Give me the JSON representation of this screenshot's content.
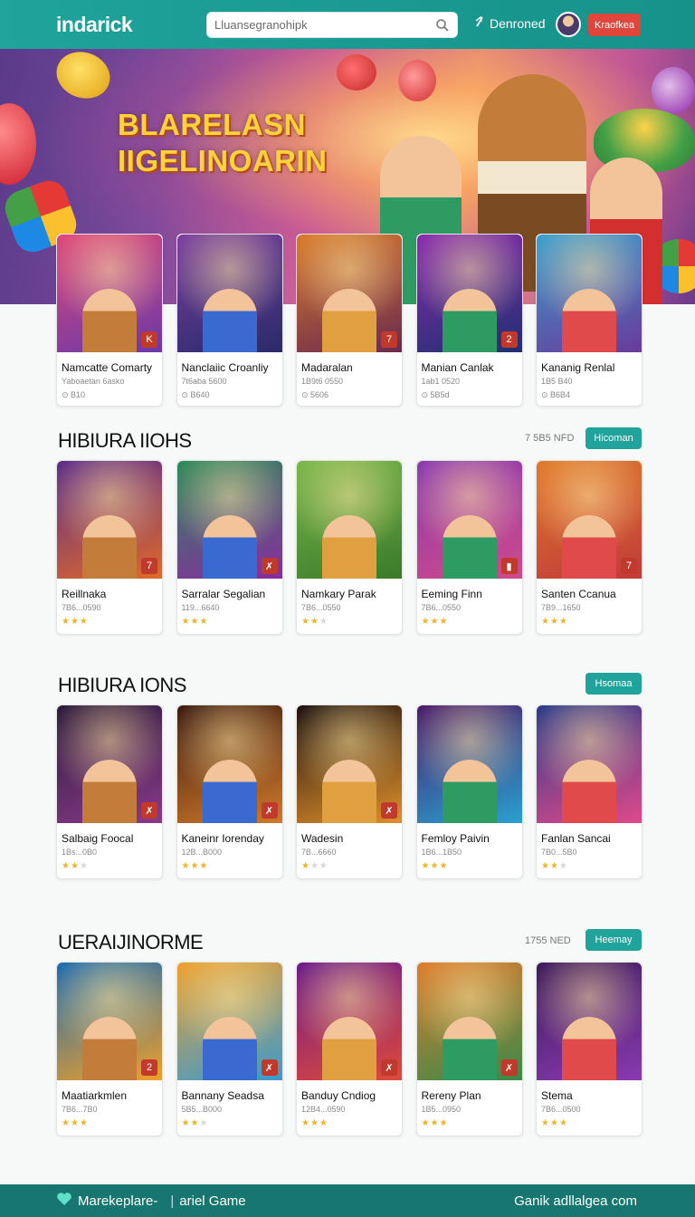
{
  "header": {
    "logo": "indarick",
    "search_placeholder": "Lluansegranohipk",
    "nav_download": "Denroned",
    "action_button": "Kraofkea"
  },
  "hero": {
    "title_line1": "BLARELASN",
    "title_line2": "IIGELINOARIN"
  },
  "featured": [
    {
      "title": "Namcatte Comarty",
      "sub": "Yaboaetan 6asko",
      "meta": "⊙ B10",
      "badge": "K"
    },
    {
      "title": "Nanclaiic Croanliy",
      "sub": "7t6aba 5600",
      "meta": "⊙ B640",
      "badge": ""
    },
    {
      "title": "Madaralan",
      "sub": "1B9t6 0550",
      "meta": "⊙ 5606",
      "badge": "7"
    },
    {
      "title": "Manian Canlak",
      "sub": "1ab1 0520",
      "meta": "⊙ 5B5d",
      "badge": "2"
    },
    {
      "title": "Kananig Renlal",
      "sub": "1B5 B40",
      "meta": "⊙ B6B4",
      "badge": ""
    }
  ],
  "sections": [
    {
      "title": "HIBIURA IIOHS",
      "count": "7 5B5 NFD",
      "button": "Hicoman",
      "items": [
        {
          "title": "Reillnaka",
          "sub": "7B6...0590",
          "rating": 3,
          "badge": "7"
        },
        {
          "title": "Sarralar Segalian",
          "sub": "119...6640",
          "rating": 3,
          "badge": "✗"
        },
        {
          "title": "Namkary Parak",
          "sub": "7B6...0550",
          "rating": 2,
          "badge": ""
        },
        {
          "title": "Eeming Finn",
          "sub": "7B6...0550",
          "rating": 3,
          "badge": "▮"
        },
        {
          "title": "Santen Ccanua",
          "sub": "7B9...1650",
          "rating": 3,
          "badge": "7"
        }
      ]
    },
    {
      "title": "HIBIURA IONS",
      "count": "",
      "button": "Hsomaa",
      "items": [
        {
          "title": "Salbaig Foocal",
          "sub": "1Bs...0B0",
          "rating": 2,
          "badge": "✗"
        },
        {
          "title": "Kaneinr Iorenday",
          "sub": "12B...B000",
          "rating": 3,
          "badge": "✗"
        },
        {
          "title": "Wadesin",
          "sub": "7B...6660",
          "rating": 1,
          "badge": "✗"
        },
        {
          "title": "Femloy Paivin",
          "sub": "1B6...1B50",
          "rating": 3,
          "badge": ""
        },
        {
          "title": "Fanlan Sancai",
          "sub": "7B0...5B0",
          "rating": 2,
          "badge": ""
        }
      ]
    },
    {
      "title": "UERAIJINORME",
      "count": "1755 NED",
      "button": "Heemay",
      "items": [
        {
          "title": "Maatiarkmlen",
          "sub": "7B6...7B0",
          "rating": 3,
          "badge": "2"
        },
        {
          "title": "Bannany Seadsa",
          "sub": "5B5...B000",
          "rating": 2,
          "badge": "✗"
        },
        {
          "title": "Banduy Cndiog",
          "sub": "12B4...0590",
          "rating": 3,
          "badge": "✗"
        },
        {
          "title": "Rereny Plan",
          "sub": "1B5...0950",
          "rating": 3,
          "badge": "✗"
        },
        {
          "title": "Stema",
          "sub": "7B6...0500",
          "rating": 3,
          "badge": ""
        }
      ]
    }
  ],
  "footer": {
    "left_brand": "Marekeplare-",
    "left_tag": "ariel Game",
    "right_text": "Ganik adllalgea com"
  },
  "colors": {
    "brand": "#1fa39a",
    "footer": "#17766f",
    "accent_red": "#e0463c",
    "star": "#f0b429"
  }
}
